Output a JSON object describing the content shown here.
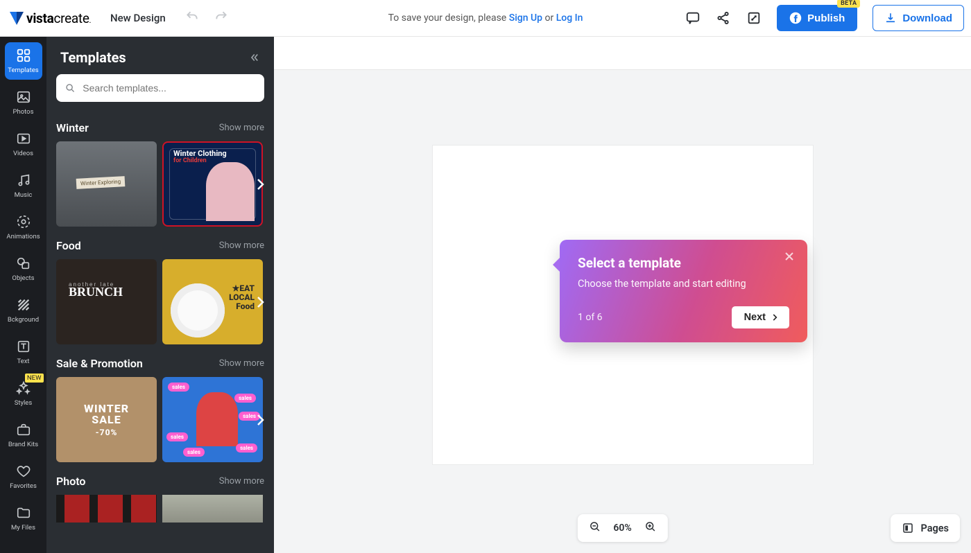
{
  "header": {
    "brand_a": "vista",
    "brand_b": "create",
    "design_name": "New Design",
    "save_prefix": "To save your design, please ",
    "signup": "Sign Up",
    "or": " or ",
    "login": "Log In",
    "publish": "Publish",
    "publish_badge": "BETA",
    "download": "Download"
  },
  "rail": {
    "templates": "Templates",
    "photos": "Photos",
    "videos": "Videos",
    "music": "Music",
    "animations": "Animations",
    "objects": "Objects",
    "background": "Bckground",
    "text": "Text",
    "styles": "Styles",
    "styles_badge": "NEW",
    "brandkits": "Brand Kits",
    "favorites": "Favorites",
    "myfiles": "My Files"
  },
  "panel": {
    "title": "Templates",
    "search_placeholder": "Search templates...",
    "show_more": "Show more",
    "categories": [
      {
        "title": "Winter"
      },
      {
        "title": "Food"
      },
      {
        "title": "Sale & Promotion"
      },
      {
        "title": "Photo"
      }
    ],
    "thumbs": {
      "winter2_title": "Winter Clothing",
      "winter2_sub": "for Children",
      "food1_small": "another late",
      "food1_big": "BRUNCH",
      "food2_txt": "★EAT\nLOCAL\nFood",
      "sale1_a": "WINTER",
      "sale1_b": "SALE",
      "sale1_c": "-70%",
      "sale2_tag": "sales"
    }
  },
  "tip": {
    "title": "Select a template",
    "body": "Choose the template and start editing",
    "step": "1 of 6",
    "next": "Next"
  },
  "footer": {
    "zoom": "60%",
    "pages": "Pages"
  }
}
